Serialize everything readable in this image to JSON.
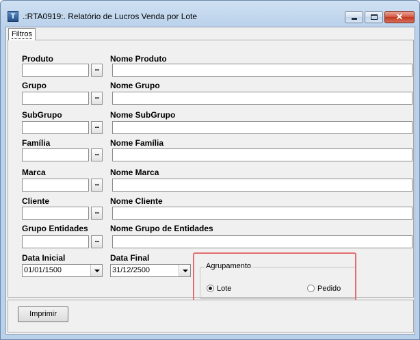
{
  "window": {
    "title": ".:RTA0919:. Relatório de Lucros Venda por Lote",
    "icon": "app-logo-icon",
    "controls": {
      "minimize": "minimize-icon",
      "maximize": "maximize-icon",
      "close_glyph": "✕"
    }
  },
  "tabs": [
    {
      "label": "Filtros",
      "active": true
    }
  ],
  "filters": {
    "produto": {
      "code_label": "Produto",
      "name_label": "Nome Produto",
      "code_value": "",
      "name_value": "",
      "button": "..."
    },
    "grupo": {
      "code_label": "Grupo",
      "name_label": "Nome Grupo",
      "code_value": "",
      "name_value": "",
      "button": "..."
    },
    "subgrupo": {
      "code_label": "SubGrupo",
      "name_label": "Nome SubGrupo",
      "code_value": "",
      "name_value": "",
      "button": "..."
    },
    "familia": {
      "code_label": "Família",
      "name_label": "Nome Família",
      "code_value": "",
      "name_value": "",
      "button": "..."
    },
    "marca": {
      "code_label": "Marca",
      "name_label": "Nome Marca",
      "code_value": "",
      "name_value": "",
      "button": "..."
    },
    "cliente": {
      "code_label": "Cliente",
      "name_label": "Nome Cliente",
      "code_value": "",
      "name_value": "",
      "button": "..."
    },
    "grupo_entidades": {
      "code_label": "Grupo Entidades",
      "name_label": "Nome Grupo de Entidades",
      "code_value": "",
      "name_value": "",
      "button": "..."
    }
  },
  "dates": {
    "inicial": {
      "label": "Data Inicial",
      "value": "01/01/1500"
    },
    "final": {
      "label": "Data Final",
      "value": "31/12/2500"
    }
  },
  "agrupamento": {
    "title": "Agrupamento",
    "options": [
      {
        "label": "Lote",
        "selected": true
      },
      {
        "label": "Pedido",
        "selected": false
      }
    ]
  },
  "actions": {
    "print_label": "Imprimir"
  },
  "colors": {
    "highlight": "#e46c70",
    "title_bar": "#b9d1ea",
    "close_button": "#c23a22"
  }
}
